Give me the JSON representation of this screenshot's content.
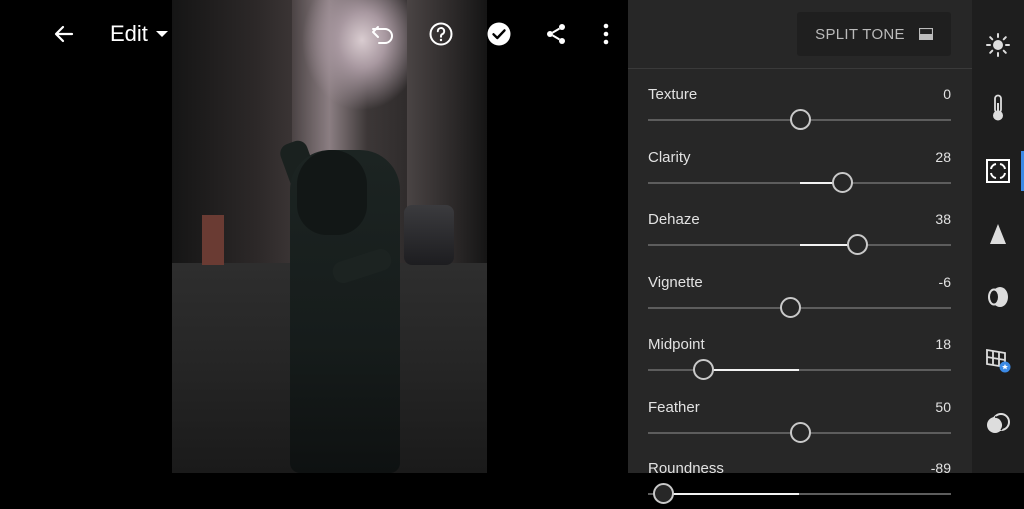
{
  "topbar": {
    "edit_label": "Edit"
  },
  "panel": {
    "header_button_label": "SPLIT TONE",
    "sliders": [
      {
        "label": "Texture",
        "value": "0",
        "position": 0.5,
        "fill_from": 0.5,
        "fill_to": 0.5
      },
      {
        "label": "Clarity",
        "value": "28",
        "position": 0.64,
        "fill_from": 0.5,
        "fill_to": 0.64
      },
      {
        "label": "Dehaze",
        "value": "38",
        "position": 0.69,
        "fill_from": 0.5,
        "fill_to": 0.69
      },
      {
        "label": "Vignette",
        "value": "-6",
        "position": 0.47,
        "fill_from": 0.47,
        "fill_to": 0.5
      },
      {
        "label": "Midpoint",
        "value": "18",
        "position": 0.18,
        "fill_from": 0.18,
        "fill_to": 0.5
      },
      {
        "label": "Feather",
        "value": "50",
        "position": 0.5,
        "fill_from": 0.5,
        "fill_to": 0.5
      },
      {
        "label": "Roundness",
        "value": "-89",
        "position": 0.05,
        "fill_from": 0.05,
        "fill_to": 0.5
      }
    ]
  },
  "rail": {
    "icons": [
      "light-icon",
      "color-icon",
      "effects-icon",
      "detail-icon",
      "optics-icon",
      "geometry-icon",
      "presets-icon"
    ],
    "active": "effects-icon",
    "accent_color": "#3b8ae6"
  }
}
